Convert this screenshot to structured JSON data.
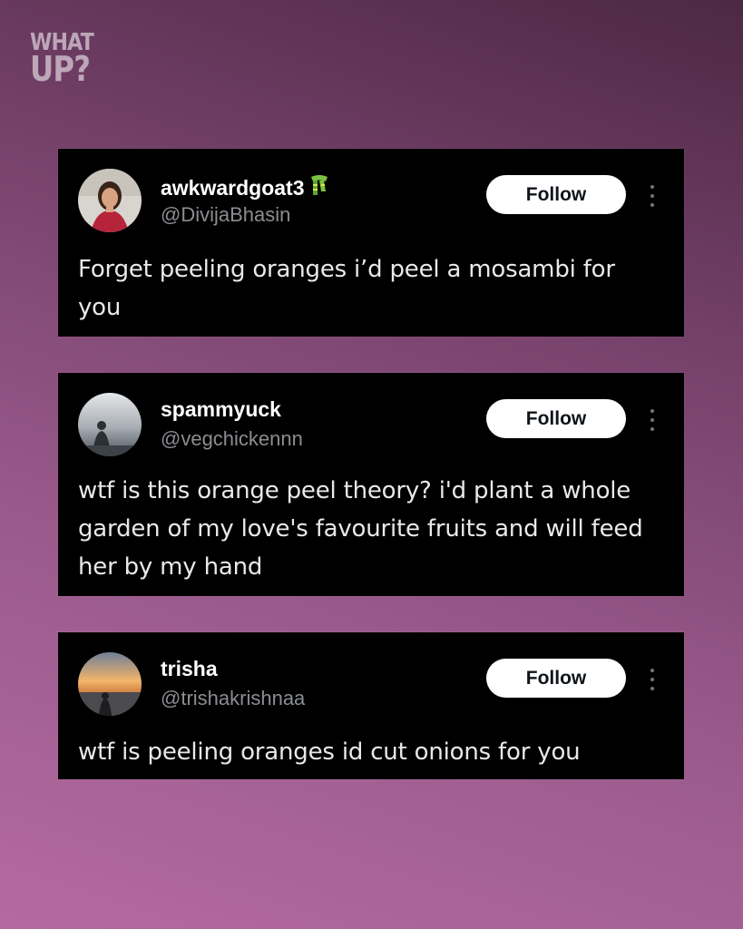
{
  "brand": {
    "line1": "WHAT",
    "line2": "UP?"
  },
  "posts": [
    {
      "display_name": "awkwardgoat3",
      "name_badge_icon": "scarf-emoji-icon",
      "handle": "@DivijaBhasin",
      "follow_label": "Follow",
      "text": "Forget peeling oranges i’d peel a mosambi for you"
    },
    {
      "display_name": "spammyuck",
      "handle": "@vegchickennn",
      "follow_label": "Follow",
      "text": "wtf is this orange peel theory? i'd plant a whole garden of my love's favourite fruits and will feed her by my hand"
    },
    {
      "display_name": "trisha",
      "handle": "@trishakrishnaa",
      "follow_label": "Follow",
      "text": "wtf is peeling oranges id cut onions for you"
    }
  ],
  "colors": {
    "card_bg": "#000000",
    "handle": "#8a8d91",
    "follow_bg": "#ffffff",
    "bg_gradient_start": "#b46aa1",
    "bg_gradient_end": "#4d2844"
  }
}
